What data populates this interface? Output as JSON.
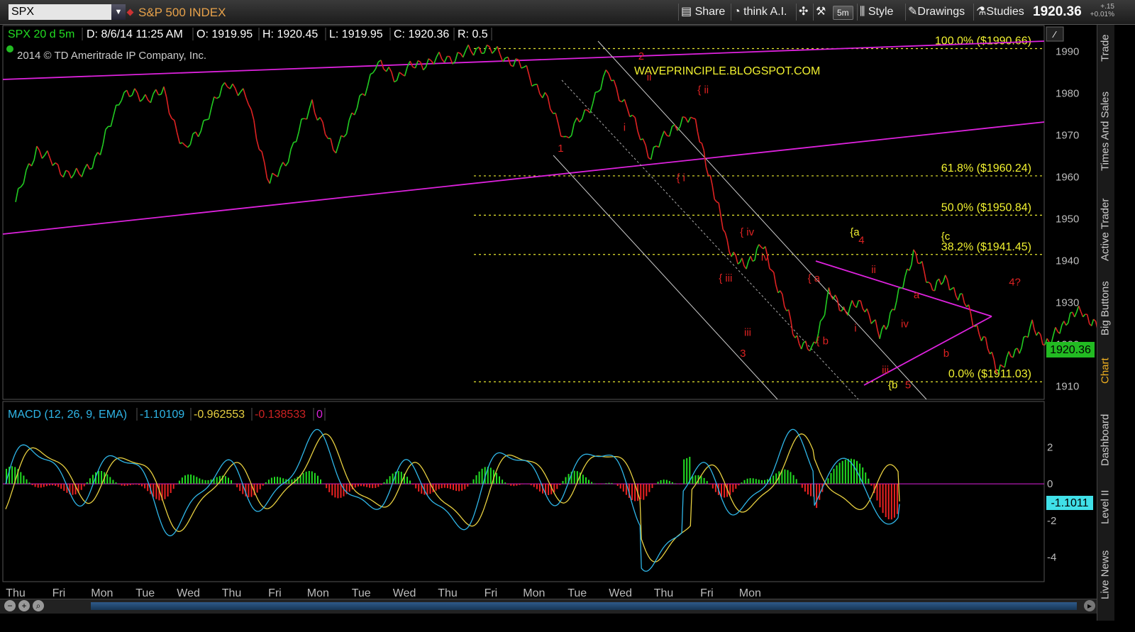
{
  "toolbar": {
    "symbol": "SPX",
    "index_name": "S&P 500 INDEX",
    "share_label": "Share",
    "thinkai_label": "think A.I.",
    "interval_label": "5m",
    "style_label": "Style",
    "drawings_label": "Drawings",
    "studies_label": "Studies",
    "last_price": "1920.36",
    "change_line1": "+.15",
    "change_line2": "+0.01%"
  },
  "header": {
    "symbol_period": "SPX 20 d 5m",
    "date": "D: 8/6/14 11:25 AM",
    "open": "O: 1919.95",
    "high": "H: 1920.45",
    "low": "L: 1919.95",
    "close": "C: 1920.36",
    "range": "R: 0.5",
    "copyright": "2014 © TD Ameritrade IP Company, Inc.",
    "watermark": "WAVEPRINCIPLE.BLOGSPOT.COM"
  },
  "macd_header": {
    "label": "MACD (12, 26, 9, EMA)",
    "value": "-1.10109",
    "avg": "-0.962553",
    "diff": "-0.138533",
    "zero": "0",
    "price_badge": "-1.1011"
  },
  "right_tabs": [
    "Trade",
    "Times And Sales",
    "Active Trader",
    "Big Buttons",
    "Chart",
    "Dashboard",
    "Level II",
    "Live News"
  ],
  "colors": {
    "price_up": "#22cc22",
    "price_down": "#dd2222",
    "trendline": "#dd22dd",
    "fib": "#e8e830",
    "channel": "#cccccc",
    "wave_label": "#dd2222",
    "macd_line": "#2fb6e8",
    "macd_avg": "#e8d040",
    "hist_up": "#22dd22",
    "hist_down": "#ee2222",
    "badge": "#22bb22"
  },
  "chart_data": [
    {
      "type": "line",
      "title": "SPX 20 d 5m",
      "x_tick_labels": [
        "Thu",
        "Fri",
        "Mon",
        "Tue",
        "Wed",
        "Thu",
        "Fri",
        "Mon",
        "Tue",
        "Wed",
        "Thu",
        "Fri",
        "Mon",
        "Tue",
        "Wed",
        "Thu",
        "Fri",
        "Mon"
      ],
      "ylim": [
        1907,
        1996
      ],
      "y_ticks": [
        1910,
        1920,
        1930,
        1940,
        1950,
        1960,
        1970,
        1980,
        1990
      ],
      "current_price_badge": "1920.36",
      "series": [
        {
          "x": [
            0,
            0.5,
            1,
            1.5,
            2,
            2.5,
            3,
            3.5,
            4,
            4.5,
            5,
            5.5,
            6,
            6.5,
            7,
            7.5,
            8,
            8.5,
            9,
            9.5,
            10,
            10.5,
            11,
            11.5,
            12,
            12.5,
            13,
            13.5,
            14,
            14.5,
            15,
            15.5,
            16
          ],
          "values": [
            1954,
            1967,
            1962,
            1960,
            1966,
            1980,
            1979,
            1980,
            1966,
            1974,
            1983,
            1978,
            1958,
            1966,
            1978,
            1966,
            1975,
            1987,
            1984,
            1987,
            1988,
            1989,
            1991,
            1989,
            1986,
            1979,
            1969,
            1976,
            1985,
            1975,
            1965,
            1972,
            1974
          ]
        },
        {
          "x": [
            16,
            16.4,
            16.8,
            17.2,
            17.6,
            18,
            18.4,
            18.8,
            19.2,
            19.6,
            20,
            20.4,
            20.8,
            21.2,
            21.6,
            22,
            22.4,
            22.8,
            23.2,
            23.6,
            24,
            24.4,
            24.8,
            25.2,
            25.6,
            26,
            26.4,
            26.8
          ],
          "values": [
            1974,
            1960,
            1944,
            1938,
            1944,
            1934,
            1922,
            1918,
            1932,
            1928,
            1930,
            1922,
            1930,
            1942,
            1934,
            1935,
            1930,
            1922,
            1914,
            1918,
            1924,
            1920,
            1926,
            1928,
            1923,
            1920,
            1920.4,
            1920.36
          ]
        }
      ],
      "fib_levels": [
        {
          "label": "100.0%  ($1990.66)",
          "value": 1990.66
        },
        {
          "label": "61.8%  ($1960.24)",
          "value": 1960.24
        },
        {
          "label": "50.0%  ($1950.84)",
          "value": 1950.84
        },
        {
          "label": "38.2%  ($1941.45)",
          "value": 1941.45
        },
        {
          "label": "0.0%  ($1911.03)",
          "value": 1911.03
        }
      ],
      "wave_labels": [
        {
          "text": "1",
          "x": 12.8,
          "y": 1966,
          "color": "red"
        },
        {
          "text": "2",
          "x": 14.7,
          "y": 1988,
          "color": "red"
        },
        {
          "text": "i",
          "x": 14.35,
          "y": 1971,
          "color": "red"
        },
        {
          "text": "ii",
          "x": 14.9,
          "y": 1983,
          "color": "red"
        },
        {
          "text": "{ ii",
          "x": 16.1,
          "y": 1980,
          "color": "red"
        },
        {
          "text": "{ i",
          "x": 15.6,
          "y": 1959,
          "color": "red"
        },
        {
          "text": "{ iv",
          "x": 17.1,
          "y": 1946,
          "color": "red"
        },
        {
          "text": "{ iii",
          "x": 16.6,
          "y": 1935,
          "color": "red"
        },
        {
          "text": "iv",
          "x": 17.6,
          "y": 1940,
          "color": "red"
        },
        {
          "text": "iii",
          "x": 17.2,
          "y": 1922,
          "color": "red"
        },
        {
          "text": "3",
          "x": 17.1,
          "y": 1917,
          "color": "red"
        },
        {
          "text": "{ a",
          "x": 18.7,
          "y": 1935,
          "color": "red"
        },
        {
          "text": "{ b",
          "x": 18.9,
          "y": 1920,
          "color": "red"
        },
        {
          "text": "{a",
          "x": 19.7,
          "y": 1946,
          "color": "yellow"
        },
        {
          "text": "4",
          "x": 19.9,
          "y": 1944,
          "color": "red"
        },
        {
          "text": "ii",
          "x": 20.2,
          "y": 1937,
          "color": "red"
        },
        {
          "text": "i",
          "x": 19.8,
          "y": 1923,
          "color": "red"
        },
        {
          "text": "iv",
          "x": 20.9,
          "y": 1924,
          "color": "red"
        },
        {
          "text": "iii",
          "x": 20.45,
          "y": 1913,
          "color": "red"
        },
        {
          "text": "{b",
          "x": 20.6,
          "y": 1909.5,
          "color": "yellow"
        },
        {
          "text": "5",
          "x": 21.0,
          "y": 1909.5,
          "color": "red"
        },
        {
          "text": "a",
          "x": 21.2,
          "y": 1931,
          "color": "red"
        },
        {
          "text": "b",
          "x": 21.9,
          "y": 1917,
          "color": "red"
        },
        {
          "text": "{c",
          "x": 21.85,
          "y": 1945,
          "color": "yellow"
        },
        {
          "text": "4?",
          "x": 23.45,
          "y": 1934,
          "color": "red"
        }
      ]
    },
    {
      "type": "line",
      "title": "MACD (12, 26, 9, EMA)",
      "ylim": [
        -5.3,
        3.3
      ],
      "y_ticks": [
        -4,
        -2,
        0,
        2
      ],
      "y_tick_labels": [
        "-4",
        "-2",
        "0",
        "2"
      ]
    }
  ]
}
